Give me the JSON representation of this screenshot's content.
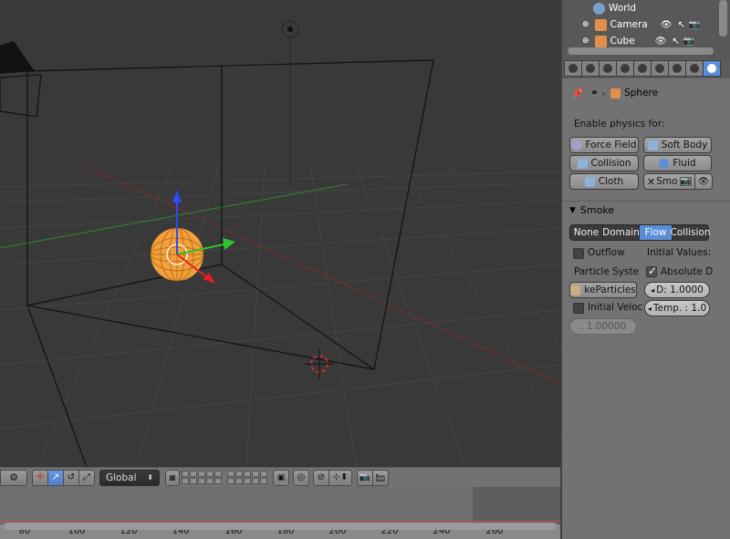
{
  "outliner": {
    "items": [
      {
        "label": "World"
      },
      {
        "label": "Camera"
      },
      {
        "label": "Cube"
      }
    ]
  },
  "properties": {
    "context_object": "Sphere",
    "enable_physics_label": "Enable physics for:",
    "physics_buttons": {
      "force_field": "Force Field",
      "soft_body": "Soft Body",
      "collision": "Collision",
      "fluid": "Fluid",
      "cloth": "Cloth",
      "smoke": "Smo"
    },
    "smoke_panel": {
      "title": "Smoke",
      "types": [
        "None",
        "Domain",
        "Flow",
        "Collision"
      ],
      "active_type": "Flow",
      "outflow_label": "Outflow",
      "outflow_checked": false,
      "initial_values_label": "Initial Values:",
      "particle_system_label": "Particle Syste",
      "particle_system_value": "keParticles",
      "absolute_density_label": "Absolute D",
      "absolute_density_checked": true,
      "density_value": "D: 1.0000",
      "initial_velocity_label": "Initial Veloc",
      "initial_velocity_checked": false,
      "temp_value": "Temp. : 1.0",
      "multiplier_value": ": 1.00000"
    }
  },
  "viewport_header": {
    "orientation_label": "Global"
  },
  "timeline": {
    "ticks": [
      "80",
      "100",
      "120",
      "140",
      "160",
      "180",
      "200",
      "220",
      "240",
      "260"
    ]
  },
  "colors": {
    "active_blue": "#5a8ed8",
    "selected_orange": "#f2a03a",
    "axis_x": "#e02020",
    "axis_y": "#30c030",
    "axis_z": "#2a4cf0"
  }
}
